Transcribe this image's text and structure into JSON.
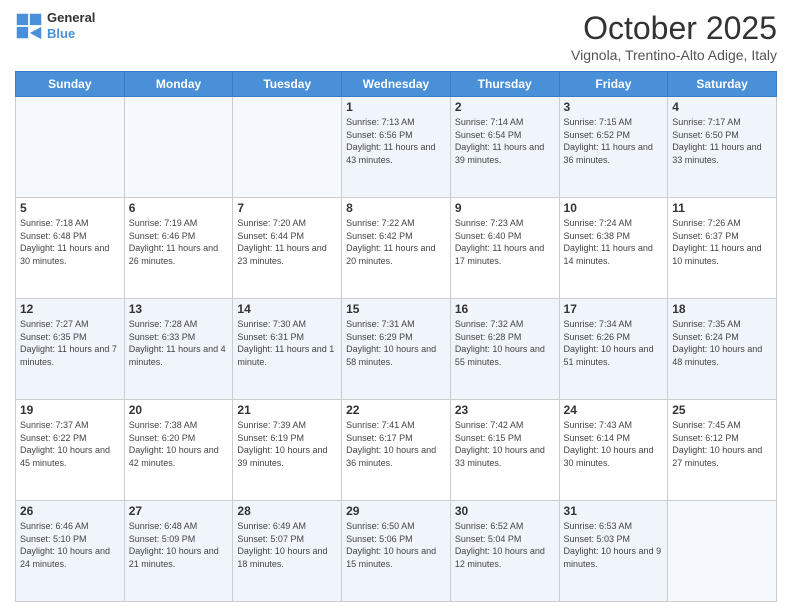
{
  "header": {
    "logo_line1": "General",
    "logo_line2": "Blue",
    "month": "October 2025",
    "location": "Vignola, Trentino-Alto Adige, Italy"
  },
  "days_of_week": [
    "Sunday",
    "Monday",
    "Tuesday",
    "Wednesday",
    "Thursday",
    "Friday",
    "Saturday"
  ],
  "weeks": [
    [
      {
        "day": "",
        "info": ""
      },
      {
        "day": "",
        "info": ""
      },
      {
        "day": "",
        "info": ""
      },
      {
        "day": "1",
        "info": "Sunrise: 7:13 AM\nSunset: 6:56 PM\nDaylight: 11 hours\nand 43 minutes."
      },
      {
        "day": "2",
        "info": "Sunrise: 7:14 AM\nSunset: 6:54 PM\nDaylight: 11 hours\nand 39 minutes."
      },
      {
        "day": "3",
        "info": "Sunrise: 7:15 AM\nSunset: 6:52 PM\nDaylight: 11 hours\nand 36 minutes."
      },
      {
        "day": "4",
        "info": "Sunrise: 7:17 AM\nSunset: 6:50 PM\nDaylight: 11 hours\nand 33 minutes."
      }
    ],
    [
      {
        "day": "5",
        "info": "Sunrise: 7:18 AM\nSunset: 6:48 PM\nDaylight: 11 hours\nand 30 minutes."
      },
      {
        "day": "6",
        "info": "Sunrise: 7:19 AM\nSunset: 6:46 PM\nDaylight: 11 hours\nand 26 minutes."
      },
      {
        "day": "7",
        "info": "Sunrise: 7:20 AM\nSunset: 6:44 PM\nDaylight: 11 hours\nand 23 minutes."
      },
      {
        "day": "8",
        "info": "Sunrise: 7:22 AM\nSunset: 6:42 PM\nDaylight: 11 hours\nand 20 minutes."
      },
      {
        "day": "9",
        "info": "Sunrise: 7:23 AM\nSunset: 6:40 PM\nDaylight: 11 hours\nand 17 minutes."
      },
      {
        "day": "10",
        "info": "Sunrise: 7:24 AM\nSunset: 6:38 PM\nDaylight: 11 hours\nand 14 minutes."
      },
      {
        "day": "11",
        "info": "Sunrise: 7:26 AM\nSunset: 6:37 PM\nDaylight: 11 hours\nand 10 minutes."
      }
    ],
    [
      {
        "day": "12",
        "info": "Sunrise: 7:27 AM\nSunset: 6:35 PM\nDaylight: 11 hours\nand 7 minutes."
      },
      {
        "day": "13",
        "info": "Sunrise: 7:28 AM\nSunset: 6:33 PM\nDaylight: 11 hours\nand 4 minutes."
      },
      {
        "day": "14",
        "info": "Sunrise: 7:30 AM\nSunset: 6:31 PM\nDaylight: 11 hours\nand 1 minute."
      },
      {
        "day": "15",
        "info": "Sunrise: 7:31 AM\nSunset: 6:29 PM\nDaylight: 10 hours\nand 58 minutes."
      },
      {
        "day": "16",
        "info": "Sunrise: 7:32 AM\nSunset: 6:28 PM\nDaylight: 10 hours\nand 55 minutes."
      },
      {
        "day": "17",
        "info": "Sunrise: 7:34 AM\nSunset: 6:26 PM\nDaylight: 10 hours\nand 51 minutes."
      },
      {
        "day": "18",
        "info": "Sunrise: 7:35 AM\nSunset: 6:24 PM\nDaylight: 10 hours\nand 48 minutes."
      }
    ],
    [
      {
        "day": "19",
        "info": "Sunrise: 7:37 AM\nSunset: 6:22 PM\nDaylight: 10 hours\nand 45 minutes."
      },
      {
        "day": "20",
        "info": "Sunrise: 7:38 AM\nSunset: 6:20 PM\nDaylight: 10 hours\nand 42 minutes."
      },
      {
        "day": "21",
        "info": "Sunrise: 7:39 AM\nSunset: 6:19 PM\nDaylight: 10 hours\nand 39 minutes."
      },
      {
        "day": "22",
        "info": "Sunrise: 7:41 AM\nSunset: 6:17 PM\nDaylight: 10 hours\nand 36 minutes."
      },
      {
        "day": "23",
        "info": "Sunrise: 7:42 AM\nSunset: 6:15 PM\nDaylight: 10 hours\nand 33 minutes."
      },
      {
        "day": "24",
        "info": "Sunrise: 7:43 AM\nSunset: 6:14 PM\nDaylight: 10 hours\nand 30 minutes."
      },
      {
        "day": "25",
        "info": "Sunrise: 7:45 AM\nSunset: 6:12 PM\nDaylight: 10 hours\nand 27 minutes."
      }
    ],
    [
      {
        "day": "26",
        "info": "Sunrise: 6:46 AM\nSunset: 5:10 PM\nDaylight: 10 hours\nand 24 minutes."
      },
      {
        "day": "27",
        "info": "Sunrise: 6:48 AM\nSunset: 5:09 PM\nDaylight: 10 hours\nand 21 minutes."
      },
      {
        "day": "28",
        "info": "Sunrise: 6:49 AM\nSunset: 5:07 PM\nDaylight: 10 hours\nand 18 minutes."
      },
      {
        "day": "29",
        "info": "Sunrise: 6:50 AM\nSunset: 5:06 PM\nDaylight: 10 hours\nand 15 minutes."
      },
      {
        "day": "30",
        "info": "Sunrise: 6:52 AM\nSunset: 5:04 PM\nDaylight: 10 hours\nand 12 minutes."
      },
      {
        "day": "31",
        "info": "Sunrise: 6:53 AM\nSunset: 5:03 PM\nDaylight: 10 hours\nand 9 minutes."
      },
      {
        "day": "",
        "info": ""
      }
    ]
  ]
}
